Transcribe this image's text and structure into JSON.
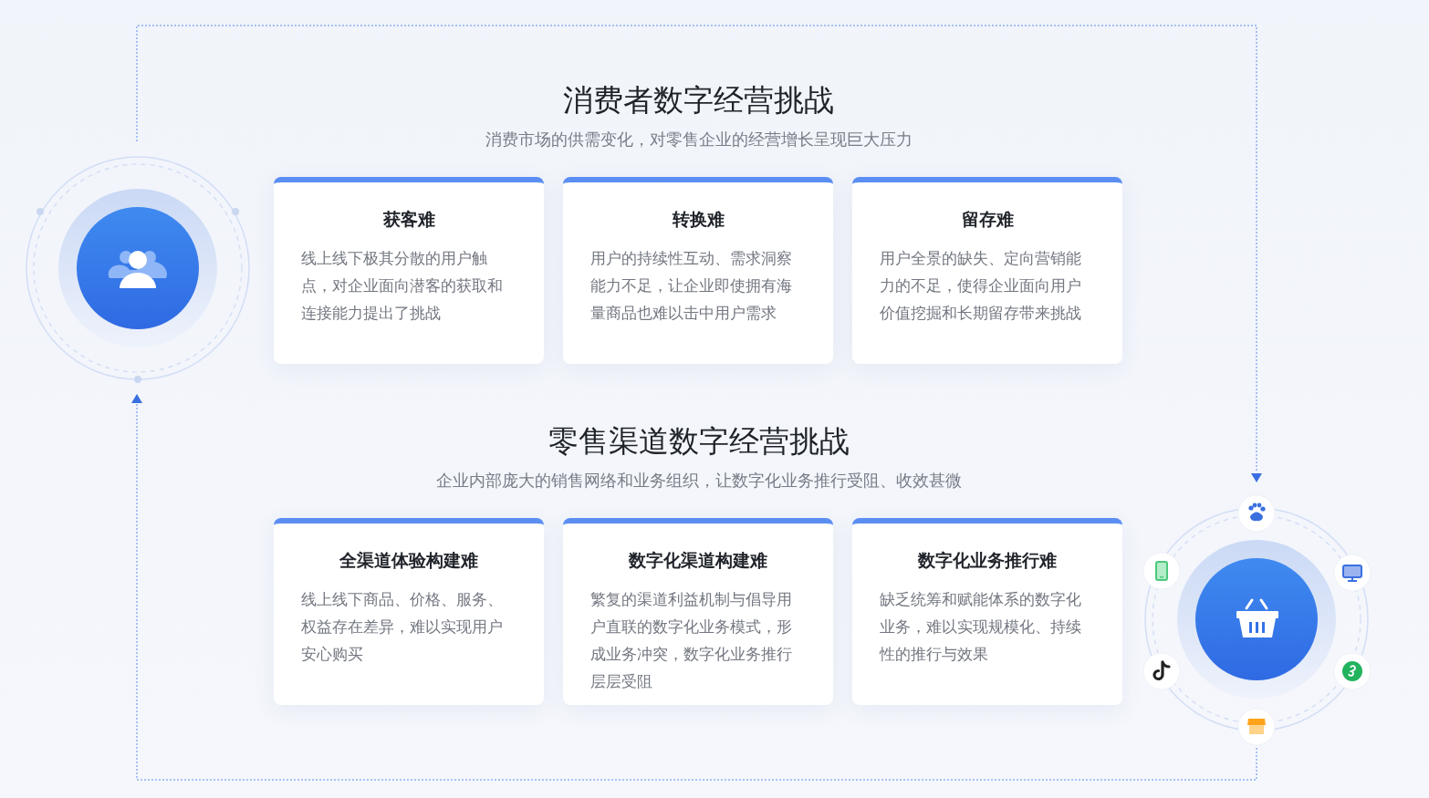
{
  "sections": [
    {
      "title": "消费者数字经营挑战",
      "subtitle": "消费市场的供需变化，对零售企业的经营增长呈现巨大压力",
      "cards": [
        {
          "title": "获客难",
          "body": "线上线下极其分散的用户触点，对企业面向潜客的获取和连接能力提出了挑战"
        },
        {
          "title": "转换难",
          "body": "用户的持续性互动、需求洞察能力不足，让企业即使拥有海量商品也难以击中用户需求"
        },
        {
          "title": "留存难",
          "body": "用户全景的缺失、定向营销能力的不足，使得企业面向用户价值挖掘和长期留存带来挑战"
        }
      ]
    },
    {
      "title": "零售渠道数字经营挑战",
      "subtitle": "企业内部庞大的销售网络和业务组织，让数字化业务推行受阻、收效甚微",
      "cards": [
        {
          "title": "全渠道体验构建难",
          "body": "线上线下商品、价格、服务、权益存在差异，难以实现用户安心购买"
        },
        {
          "title": "数字化渠道构建难",
          "body": "繁复的渠道利益机制与倡导用户直联的数字化业务模式，形成业务冲突，数字化业务推行层层受阻"
        },
        {
          "title": "数字化业务推行难",
          "body": "缺乏统筹和赋能体系的数字化业务，难以实现规模化、持续性的推行与效果"
        }
      ]
    }
  ]
}
